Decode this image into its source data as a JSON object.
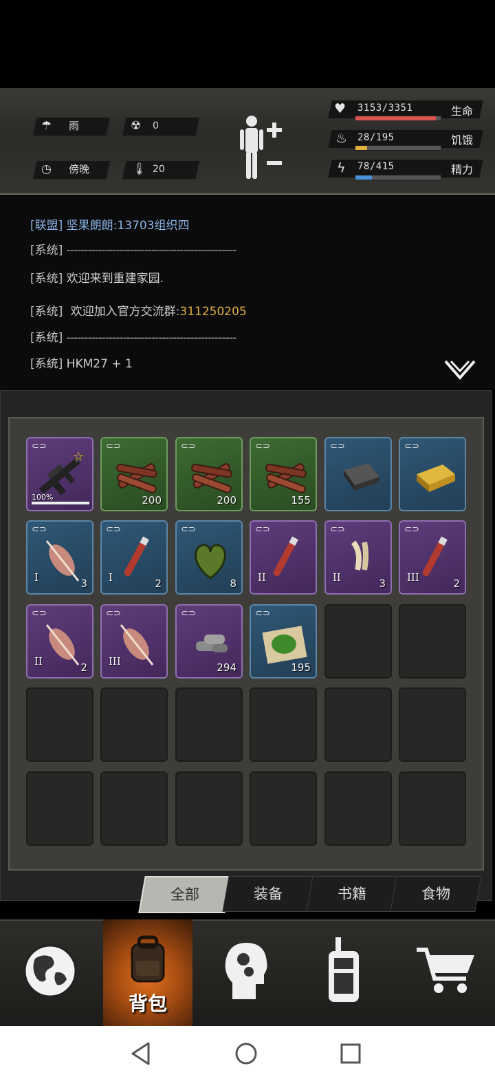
{
  "environment": {
    "weather": "雨",
    "radiation": "0",
    "time_of_day": "傍晚",
    "temperature": "20"
  },
  "stats": {
    "health": {
      "value": "3153/3351",
      "label": "生命",
      "fraction": 0.94,
      "color": "#d9534f"
    },
    "hunger": {
      "value": "28/195",
      "label": "饥饿",
      "fraction": 0.14,
      "color": "#e0b040"
    },
    "energy": {
      "value": "78/415",
      "label": "精力",
      "fraction": 0.19,
      "color": "#4a90d9"
    }
  },
  "chat": {
    "lines": [
      {
        "tag": "[联盟]",
        "text": "坚果朗朗:13703组织四"
      },
      {
        "tag": "[系统]",
        "text": "------------------------------------------------"
      },
      {
        "tag": "[系统]",
        "text": "欢迎来到重建家园."
      },
      {
        "tag": "[系统]",
        "text": "欢迎加入官方交流群:",
        "highlight": "311250205"
      },
      {
        "tag": "[系统]",
        "text": "------------------------------------------------"
      },
      {
        "tag": "[系统]",
        "text": "HKM27 + 1"
      }
    ]
  },
  "inventory": {
    "items": [
      {
        "name": "assault-rifle",
        "rarity": "purple",
        "durability": "100%",
        "qty": ""
      },
      {
        "name": "firewood",
        "rarity": "green",
        "qty": "200"
      },
      {
        "name": "firewood",
        "rarity": "green",
        "qty": "200"
      },
      {
        "name": "firewood",
        "rarity": "green",
        "qty": "155"
      },
      {
        "name": "iron-ingot",
        "rarity": "blue",
        "qty": ""
      },
      {
        "name": "gold-ingot",
        "rarity": "blue",
        "qty": ""
      },
      {
        "name": "meat",
        "rarity": "blue",
        "tier": "I",
        "qty": "3"
      },
      {
        "name": "blood-vial",
        "rarity": "blue",
        "tier": "I",
        "qty": "2"
      },
      {
        "name": "heart-organ",
        "rarity": "blue",
        "qty": "8"
      },
      {
        "name": "blood-vial",
        "rarity": "purple",
        "tier": "II",
        "qty": ""
      },
      {
        "name": "claws",
        "rarity": "purple",
        "tier": "II",
        "qty": "3"
      },
      {
        "name": "blood-vial",
        "rarity": "purple",
        "tier": "III",
        "qty": "2"
      },
      {
        "name": "meat",
        "rarity": "purple",
        "tier": "II",
        "qty": "2"
      },
      {
        "name": "meat",
        "rarity": "purple",
        "tier": "III",
        "qty": ""
      },
      {
        "name": "bullets",
        "rarity": "purple",
        "qty": "294"
      },
      {
        "name": "cabbage-seeds",
        "rarity": "blue",
        "qty": "195"
      }
    ],
    "total_slots": 30
  },
  "tabs": [
    {
      "label": "全部",
      "active": true
    },
    {
      "label": "装备",
      "active": false
    },
    {
      "label": "书籍",
      "active": false
    },
    {
      "label": "食物",
      "active": false
    }
  ],
  "nav": {
    "backpack_label": "背包"
  }
}
